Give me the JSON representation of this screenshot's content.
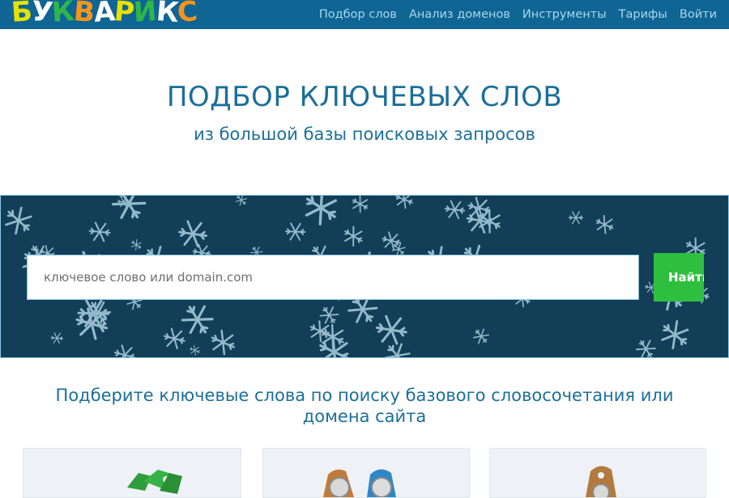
{
  "logo": {
    "letters": [
      {
        "char": "Б",
        "color": "#e8e000"
      },
      {
        "char": "У",
        "color": "#ffffff"
      },
      {
        "char": "К",
        "color": "#2fb64a"
      },
      {
        "char": "В",
        "color": "#f7941d"
      },
      {
        "char": "А",
        "color": "#ffffff"
      },
      {
        "char": "Р",
        "color": "#e8e000"
      },
      {
        "char": "И",
        "color": "#2fb64a"
      },
      {
        "char": "К",
        "color": "#ffffff"
      },
      {
        "char": "С",
        "color": "#f7941d"
      }
    ]
  },
  "nav": {
    "items": [
      {
        "label": "Подбор слов"
      },
      {
        "label": "Анализ доменов"
      },
      {
        "label": "Инструменты"
      },
      {
        "label": "Тарифы"
      },
      {
        "label": "Войти"
      }
    ]
  },
  "hero": {
    "title": "ПОДБОР КЛЮЧЕВЫХ СЛОВ",
    "subtitle": "из большой базы поисковых запросов"
  },
  "search": {
    "placeholder": "ключевое слово или domain.com",
    "button_label": "Найти"
  },
  "section": {
    "title_line1": "Подберите ключевые слова по поиску базового словосочетания или",
    "title_line2": "домена сайта"
  },
  "cards": [
    {
      "icon": "green-tags-icon"
    },
    {
      "icon": "orange-blue-tags-icon"
    },
    {
      "icon": "brown-tag-icon"
    }
  ],
  "colors": {
    "header_bg": "#0f6593",
    "nav_text": "#a6d7f0",
    "heading": "#1b6f99",
    "search_bg": "#123e58",
    "button_green": "#2fbf3f"
  }
}
